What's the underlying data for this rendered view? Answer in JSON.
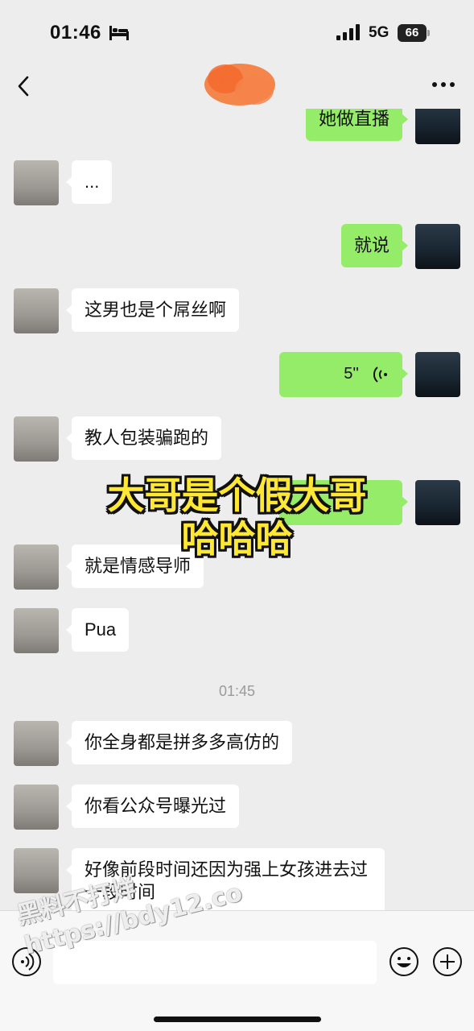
{
  "status_bar": {
    "time": "01:46",
    "network": "5G",
    "battery": "66"
  },
  "nav": {
    "contact_name": "•"
  },
  "messages": [
    {
      "side": "me",
      "text": "她做直播"
    },
    {
      "side": "them",
      "text": "..."
    },
    {
      "side": "me",
      "text": "就说"
    },
    {
      "side": "them",
      "text": "这男也是个屌丝啊"
    },
    {
      "side": "me",
      "type": "voice",
      "duration": "5''"
    },
    {
      "side": "them",
      "text": "教人包装骗跑的"
    },
    {
      "side": "me",
      "text": ""
    },
    {
      "side": "them",
      "text": "就是情感导师"
    },
    {
      "side": "them",
      "text": "Pua"
    },
    {
      "side": "them",
      "text": "你全身都是拼多多高仿的"
    },
    {
      "side": "them",
      "text": "你看公众号曝光过"
    },
    {
      "side": "them",
      "text": "好像前段时间还因为强上女孩进去过一段时间"
    }
  ],
  "timestamp": "01:45",
  "overlay_caption": {
    "line1": "大哥是个假大哥",
    "line2": "哈哈哈"
  },
  "watermark": {
    "line1": "黑料不打烊",
    "line2": "https://bdy12.co"
  },
  "colors": {
    "background": "#ededed",
    "my_bubble": "#95ec69",
    "their_bubble": "#ffffff",
    "caption": "#ffe833"
  }
}
